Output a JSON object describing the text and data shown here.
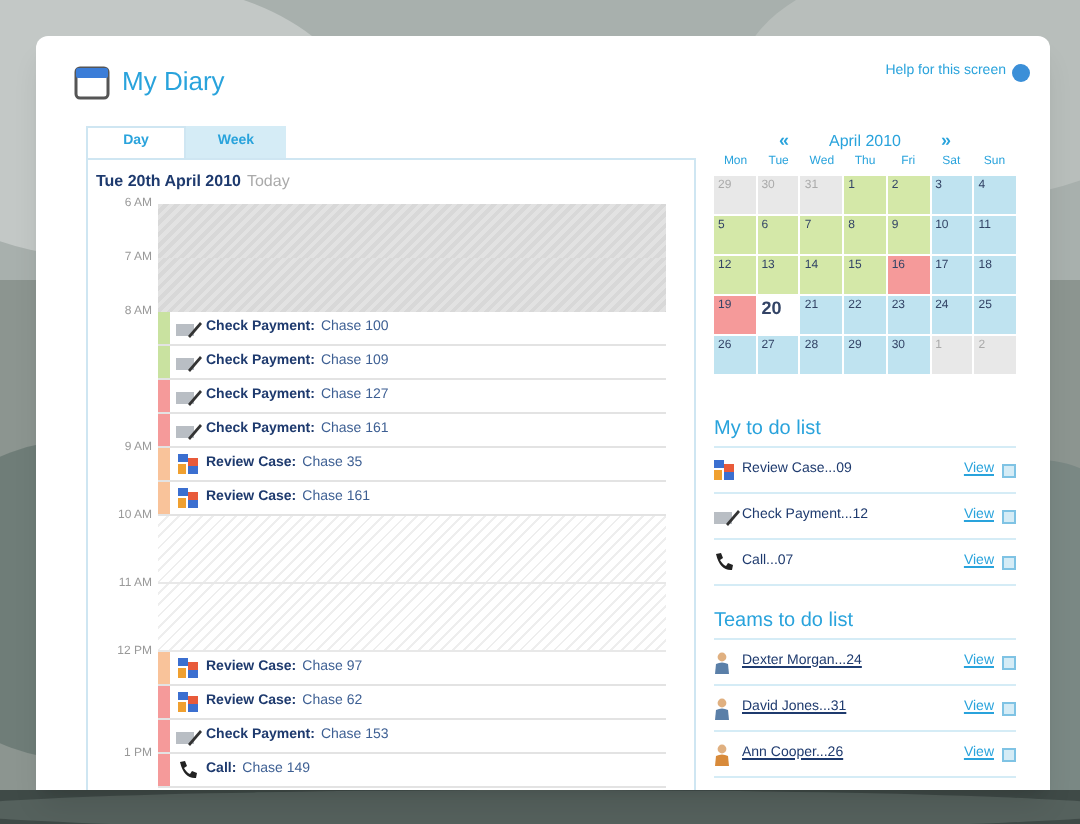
{
  "window": {
    "title": "My Diary",
    "help_link": "Help for this screen"
  },
  "tabs": [
    {
      "label": "Day",
      "selected": true
    },
    {
      "label": "Week",
      "selected": false
    }
  ],
  "day_view": {
    "date": "Tue 20th April 2010",
    "date_note": "Today",
    "timeline": [
      {
        "kind": "closed",
        "time": "6 AM"
      },
      {
        "kind": "closed",
        "time": "7 AM"
      },
      {
        "kind": "payment",
        "time": "8 AM",
        "title": "Check Payment:",
        "detail": "Chase 100",
        "color": "#c9e2a0"
      },
      {
        "kind": "payment",
        "title": "Check Payment:",
        "detail": "Chase 109",
        "color": "#c9e2a0"
      },
      {
        "kind": "payment",
        "title": "Check Payment:",
        "detail": "Chase 127",
        "color": "#f59a9a"
      },
      {
        "kind": "payment",
        "title": "Check Payment:",
        "detail": "Chase 161",
        "color": "#f59a9a"
      },
      {
        "kind": "review",
        "time": "9 AM",
        "title": "Review Case:",
        "detail": "Chase 35",
        "color": "#f9c39a"
      },
      {
        "kind": "review",
        "title": "Review Case:",
        "detail": "Chase 161",
        "color": "#f9c39a"
      },
      {
        "kind": "free",
        "time": "10 AM"
      },
      {
        "kind": "free",
        "time": "11 AM"
      },
      {
        "kind": "review",
        "time": "12 PM",
        "title": "Review Case:",
        "detail": "Chase 97",
        "color": "#f9c39a"
      },
      {
        "kind": "review",
        "title": "Review Case:",
        "detail": "Chase 62",
        "color": "#f59a9a"
      },
      {
        "kind": "payment",
        "title": "Check Payment:",
        "detail": "Chase 153",
        "color": "#f59a9a"
      },
      {
        "kind": "call",
        "time": "1 PM",
        "title": "Call:",
        "detail": "Chase 149",
        "color": "#f59a9a"
      }
    ]
  },
  "calendar": {
    "prev": "«",
    "month": "April 2010",
    "next": "»",
    "weekdays": [
      "Mon",
      "Tue",
      "Wed",
      "Thu",
      "Fri",
      "Sat",
      "Sun"
    ],
    "days": [
      {
        "label": "29",
        "color": "#e8e8e8",
        "outside_month": true,
        "today": false
      },
      {
        "label": "30",
        "color": "#e8e8e8",
        "outside_month": true,
        "today": false
      },
      {
        "label": "31",
        "color": "#e8e8e8",
        "outside_month": true,
        "today": false
      },
      {
        "label": "1",
        "color": "#d4e8a8",
        "outside_month": false,
        "today": false
      },
      {
        "label": "2",
        "color": "#d4e8a8",
        "outside_month": false,
        "today": false
      },
      {
        "label": "3",
        "color": "#bfe3f0",
        "outside_month": false,
        "today": false
      },
      {
        "label": "4",
        "color": "#bfe3f0",
        "outside_month": false,
        "today": false
      },
      {
        "label": "5",
        "color": "#d4e8a8",
        "outside_month": false,
        "today": false
      },
      {
        "label": "6",
        "color": "#d4e8a8",
        "outside_month": false,
        "today": false
      },
      {
        "label": "7",
        "color": "#d4e8a8",
        "outside_month": false,
        "today": false
      },
      {
        "label": "8",
        "color": "#d4e8a8",
        "outside_month": false,
        "today": false
      },
      {
        "label": "9",
        "color": "#d4e8a8",
        "outside_month": false,
        "today": false
      },
      {
        "label": "10",
        "color": "#bfe3f0",
        "outside_month": false,
        "today": false
      },
      {
        "label": "11",
        "color": "#bfe3f0",
        "outside_month": false,
        "today": false
      },
      {
        "label": "12",
        "color": "#d4e8a8",
        "outside_month": false,
        "today": false
      },
      {
        "label": "13",
        "color": "#d4e8a8",
        "outside_month": false,
        "today": false
      },
      {
        "label": "14",
        "color": "#d4e8a8",
        "outside_month": false,
        "today": false
      },
      {
        "label": "15",
        "color": "#d4e8a8",
        "outside_month": false,
        "today": false
      },
      {
        "label": "16",
        "color": "#f59a9a",
        "outside_month": false,
        "today": false
      },
      {
        "label": "17",
        "color": "#bfe3f0",
        "outside_month": false,
        "today": false
      },
      {
        "label": "18",
        "color": "#bfe3f0",
        "outside_month": false,
        "today": false
      },
      {
        "label": "19",
        "color": "#f59a9a",
        "outside_month": false,
        "today": false
      },
      {
        "label": "20",
        "color": "#ffffff",
        "outside_month": false,
        "today": true
      },
      {
        "label": "21",
        "color": "#bfe3f0",
        "outside_month": false,
        "today": false
      },
      {
        "label": "22",
        "color": "#bfe3f0",
        "outside_month": false,
        "today": false
      },
      {
        "label": "23",
        "color": "#bfe3f0",
        "outside_month": false,
        "today": false
      },
      {
        "label": "24",
        "color": "#bfe3f0",
        "outside_month": false,
        "today": false
      },
      {
        "label": "25",
        "color": "#bfe3f0",
        "outside_month": false,
        "today": false
      },
      {
        "label": "26",
        "color": "#bfe3f0",
        "outside_month": false,
        "today": false
      },
      {
        "label": "27",
        "color": "#bfe3f0",
        "outside_month": false,
        "today": false
      },
      {
        "label": "28",
        "color": "#bfe3f0",
        "outside_month": false,
        "today": false
      },
      {
        "label": "29",
        "color": "#bfe3f0",
        "outside_month": false,
        "today": false
      },
      {
        "label": "30",
        "color": "#bfe3f0",
        "outside_month": false,
        "today": false
      },
      {
        "label": "1",
        "color": "#e8e8e8",
        "outside_month": true,
        "today": false
      },
      {
        "label": "2",
        "color": "#e8e8e8",
        "outside_month": true,
        "today": false
      }
    ]
  },
  "my_todo": {
    "title": "My to do list",
    "items": [
      {
        "kind": "review",
        "label": "Review Case...09",
        "action": "View"
      },
      {
        "kind": "payment",
        "label": "Check Payment...12",
        "action": "View"
      },
      {
        "kind": "call",
        "label": "Call...07",
        "action": "View"
      }
    ]
  },
  "team_todo": {
    "title": "Teams to do list",
    "items": [
      {
        "kind": "male",
        "label": "Dexter Morgan...24",
        "action": "View"
      },
      {
        "kind": "male",
        "label": "David Jones...31",
        "action": "View"
      },
      {
        "kind": "female",
        "label": "Ann Cooper...26",
        "action": "View"
      }
    ]
  }
}
